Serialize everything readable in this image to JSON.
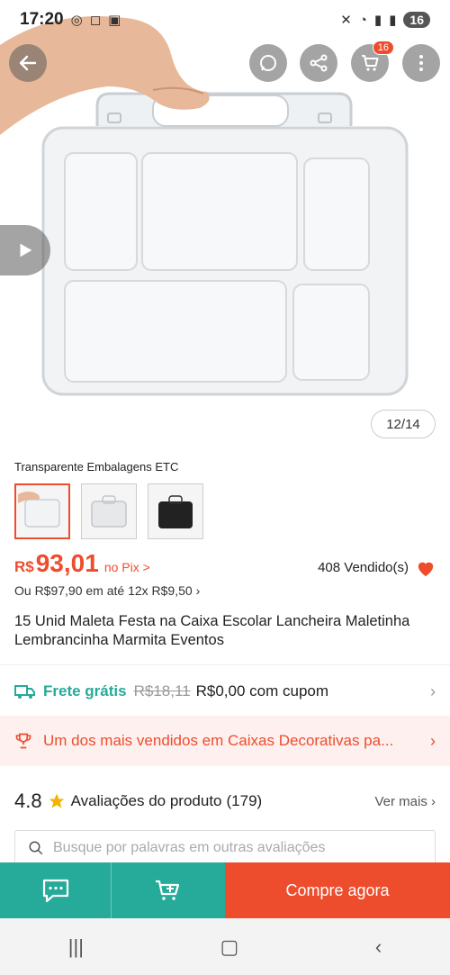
{
  "status": {
    "time": "17:20",
    "battery": "16"
  },
  "header": {
    "cart_count": "16"
  },
  "gallery": {
    "counter": "12/14"
  },
  "seller": {
    "name": "Transparente Embalagens ETC"
  },
  "price": {
    "currency": "R$",
    "value": "93,01",
    "pix_label": "no Pix >",
    "sold": "408 Vendido(s)",
    "installments": "Ou R$97,90 em até 12x R$9,50 ›"
  },
  "product": {
    "title": "15 Unid Maleta Festa na Caixa Escolar Lancheira Maletinha Lembrancinha Marmita Eventos"
  },
  "shipping": {
    "free_label": "Frete grátis",
    "old_price": "R$18,11",
    "new_price": "R$0,00 com cupom"
  },
  "bestseller": {
    "text": "Um dos mais vendidos em Caixas Decorativas pa..."
  },
  "reviews": {
    "rating": "4.8",
    "label": "Avaliações do produto",
    "count": "(179)",
    "see_more": "Ver mais",
    "search_placeholder": "Busque por palavras em outras avaliações"
  },
  "actions": {
    "buy_now": "Compre agora"
  },
  "colors": {
    "accent": "#ee4d2d",
    "teal": "#26aa99"
  }
}
